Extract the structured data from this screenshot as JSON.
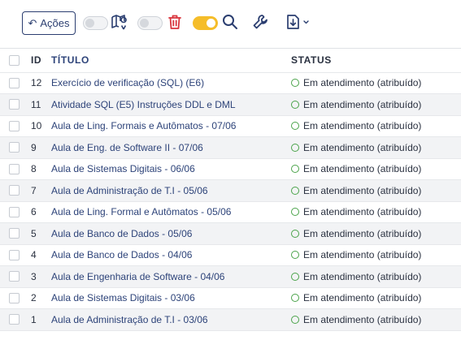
{
  "toolbar": {
    "actions_label": "Ações",
    "toggles": [
      {
        "state": "off"
      },
      {
        "state": "off"
      },
      {
        "state": "on"
      }
    ],
    "accent_color": "#f5bd2a",
    "danger_color": "#d9363e",
    "brand_color": "#2b3e70"
  },
  "table": {
    "headers": {
      "id": "ID",
      "title": "TÍTULO",
      "status": "STATUS"
    },
    "status_color": "#4aa34a",
    "rows": [
      {
        "id": "12",
        "title": "Exercício de verificação (SQL) (E6)",
        "status": "Em atendimento (atribuído)"
      },
      {
        "id": "11",
        "title": "Atividade SQL (E5) Instruções DDL e DML",
        "status": "Em atendimento (atribuído)"
      },
      {
        "id": "10",
        "title": "Aula de Ling. Formais e Autômatos - 07/06",
        "status": "Em atendimento (atribuído)"
      },
      {
        "id": "9",
        "title": "Aula de Eng. de Software II - 07/06",
        "status": "Em atendimento (atribuído)"
      },
      {
        "id": "8",
        "title": "Aula de Sistemas Digitais - 06/06",
        "status": "Em atendimento (atribuído)"
      },
      {
        "id": "7",
        "title": "Aula de Administração de T.I - 05/06",
        "status": "Em atendimento (atribuído)"
      },
      {
        "id": "6",
        "title": "Aula de Ling. Formal e Autômatos - 05/06",
        "status": "Em atendimento (atribuído)"
      },
      {
        "id": "5",
        "title": "Aula de Banco de Dados - 05/06",
        "status": "Em atendimento (atribuído)"
      },
      {
        "id": "4",
        "title": "Aula de Banco de Dados - 04/06",
        "status": "Em atendimento (atribuído)"
      },
      {
        "id": "3",
        "title": "Aula de Engenharia de Software - 04/06",
        "status": "Em atendimento (atribuído)"
      },
      {
        "id": "2",
        "title": "Aula de Sistemas Digitais - 03/06",
        "status": "Em atendimento (atribuído)"
      },
      {
        "id": "1",
        "title": "Aula de Administração de T.I - 03/06",
        "status": "Em atendimento (atribuído)"
      }
    ]
  }
}
